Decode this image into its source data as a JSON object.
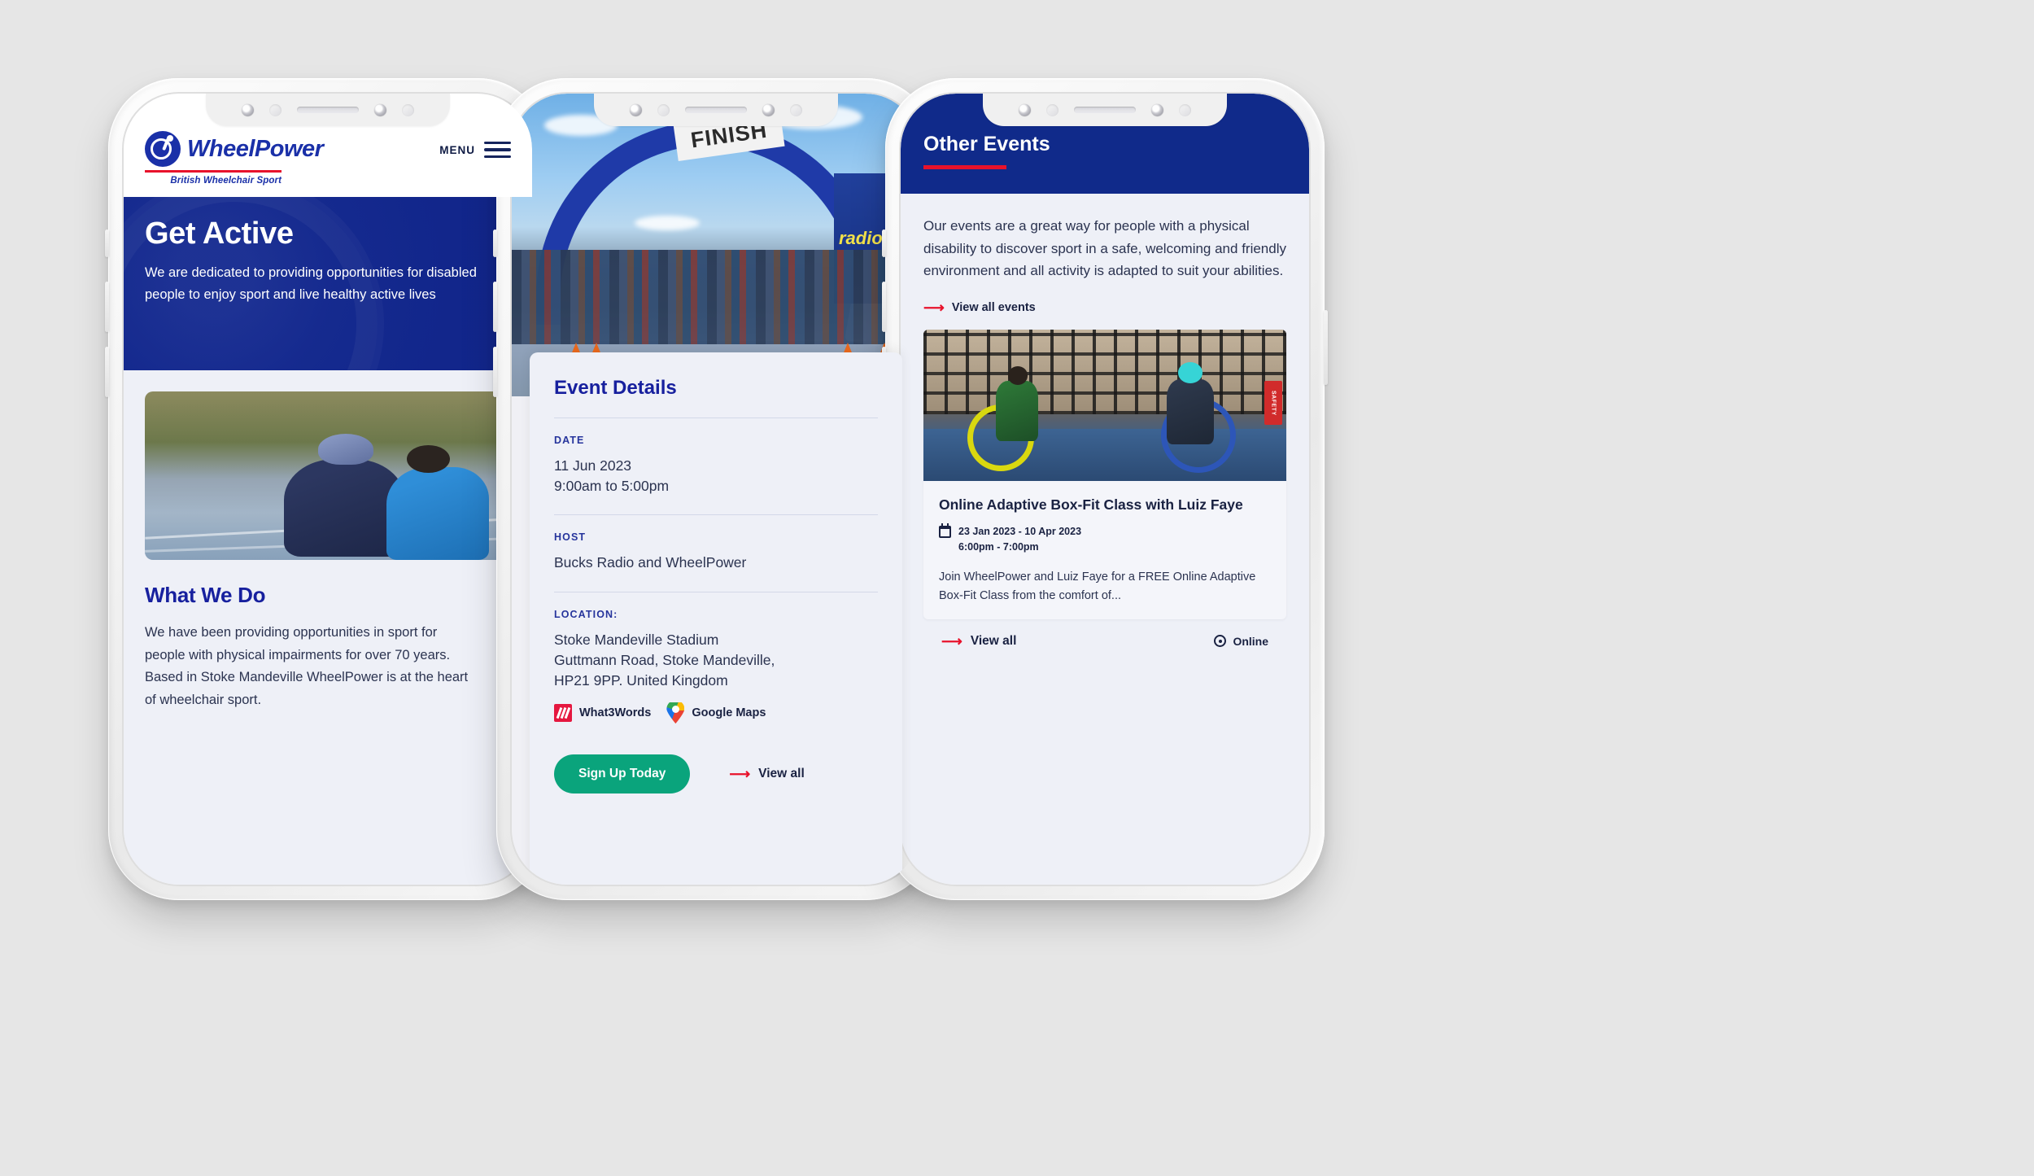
{
  "phone1": {
    "brand": {
      "name": "WheelPower",
      "tagline": "British Wheelchair Sport",
      "logo_icon": "wheelchair-athlete-icon",
      "accent_blue": "#1a30a8",
      "accent_red": "#e8122b"
    },
    "nav": {
      "menu_label": "MENU",
      "menu_icon": "hamburger-icon"
    },
    "hero": {
      "title": "Get Active",
      "text": "We are dedicated to providing opportunities for disabled people to enjoy sport and live healthy active lives",
      "background_color": "#10258c"
    },
    "section": {
      "image_alt": "handcyclist-on-track-with-coach",
      "title": "What We Do",
      "text": "We have been providing opportunities in sport for people with physical impairments for over 70 years. Based in Stoke Mandeville WheelPower is at the heart of wheelchair sport."
    }
  },
  "phone2": {
    "photo": {
      "alt": "cyclists-crossing-finish-arch",
      "sign_text": "FINISH",
      "banner_text": "radio"
    },
    "card": {
      "title": "Event Details",
      "fields": [
        {
          "label": "DATE",
          "lines": [
            "11 Jun 2023",
            "9:00am to 5:00pm"
          ]
        },
        {
          "label": "HOST",
          "lines": [
            "Bucks Radio and WheelPower"
          ]
        },
        {
          "label": "LOCATION:",
          "lines": [
            "Stoke Mandeville Stadium",
            "Guttmann Road, Stoke Mandeville,",
            "HP21 9PP. United Kingdom"
          ]
        }
      ],
      "map_links": [
        {
          "label": "What3Words",
          "icon": "what3words-icon"
        },
        {
          "label": "Google Maps",
          "icon": "google-maps-pin-icon"
        }
      ],
      "signup_label": "Sign Up Today",
      "signup_color": "#0aa47c",
      "view_all_label": "View all",
      "view_all_icon": "arrow-right-icon"
    }
  },
  "phone3": {
    "header": {
      "title": "Other Events",
      "background_color": "#102a8a",
      "rule_color": "#e8122b"
    },
    "intro": {
      "text": "Our events are a great way for people with a physical disability to discover sport in a safe, welcoming and friendly environment and all activity is adapted to suit your abilities.",
      "link_label": "View all events",
      "link_icon": "arrow-right-icon"
    },
    "event_card": {
      "image_alt": "two-wheelchair-users-in-gym",
      "title": "Online Adaptive Box-Fit Class with Luiz Faye",
      "date_icon": "calendar-icon",
      "date_range": "23 Jan 2023 - 10 Apr 2023",
      "time_range": "6:00pm - 7:00pm",
      "description": "Join WheelPower and Luiz Faye for a FREE Online Adaptive Box-Fit Class from the comfort of...",
      "footer": {
        "view_all_label": "View all",
        "view_all_icon": "arrow-right-icon",
        "location_label": "Online",
        "location_icon": "map-pin-icon"
      }
    }
  }
}
